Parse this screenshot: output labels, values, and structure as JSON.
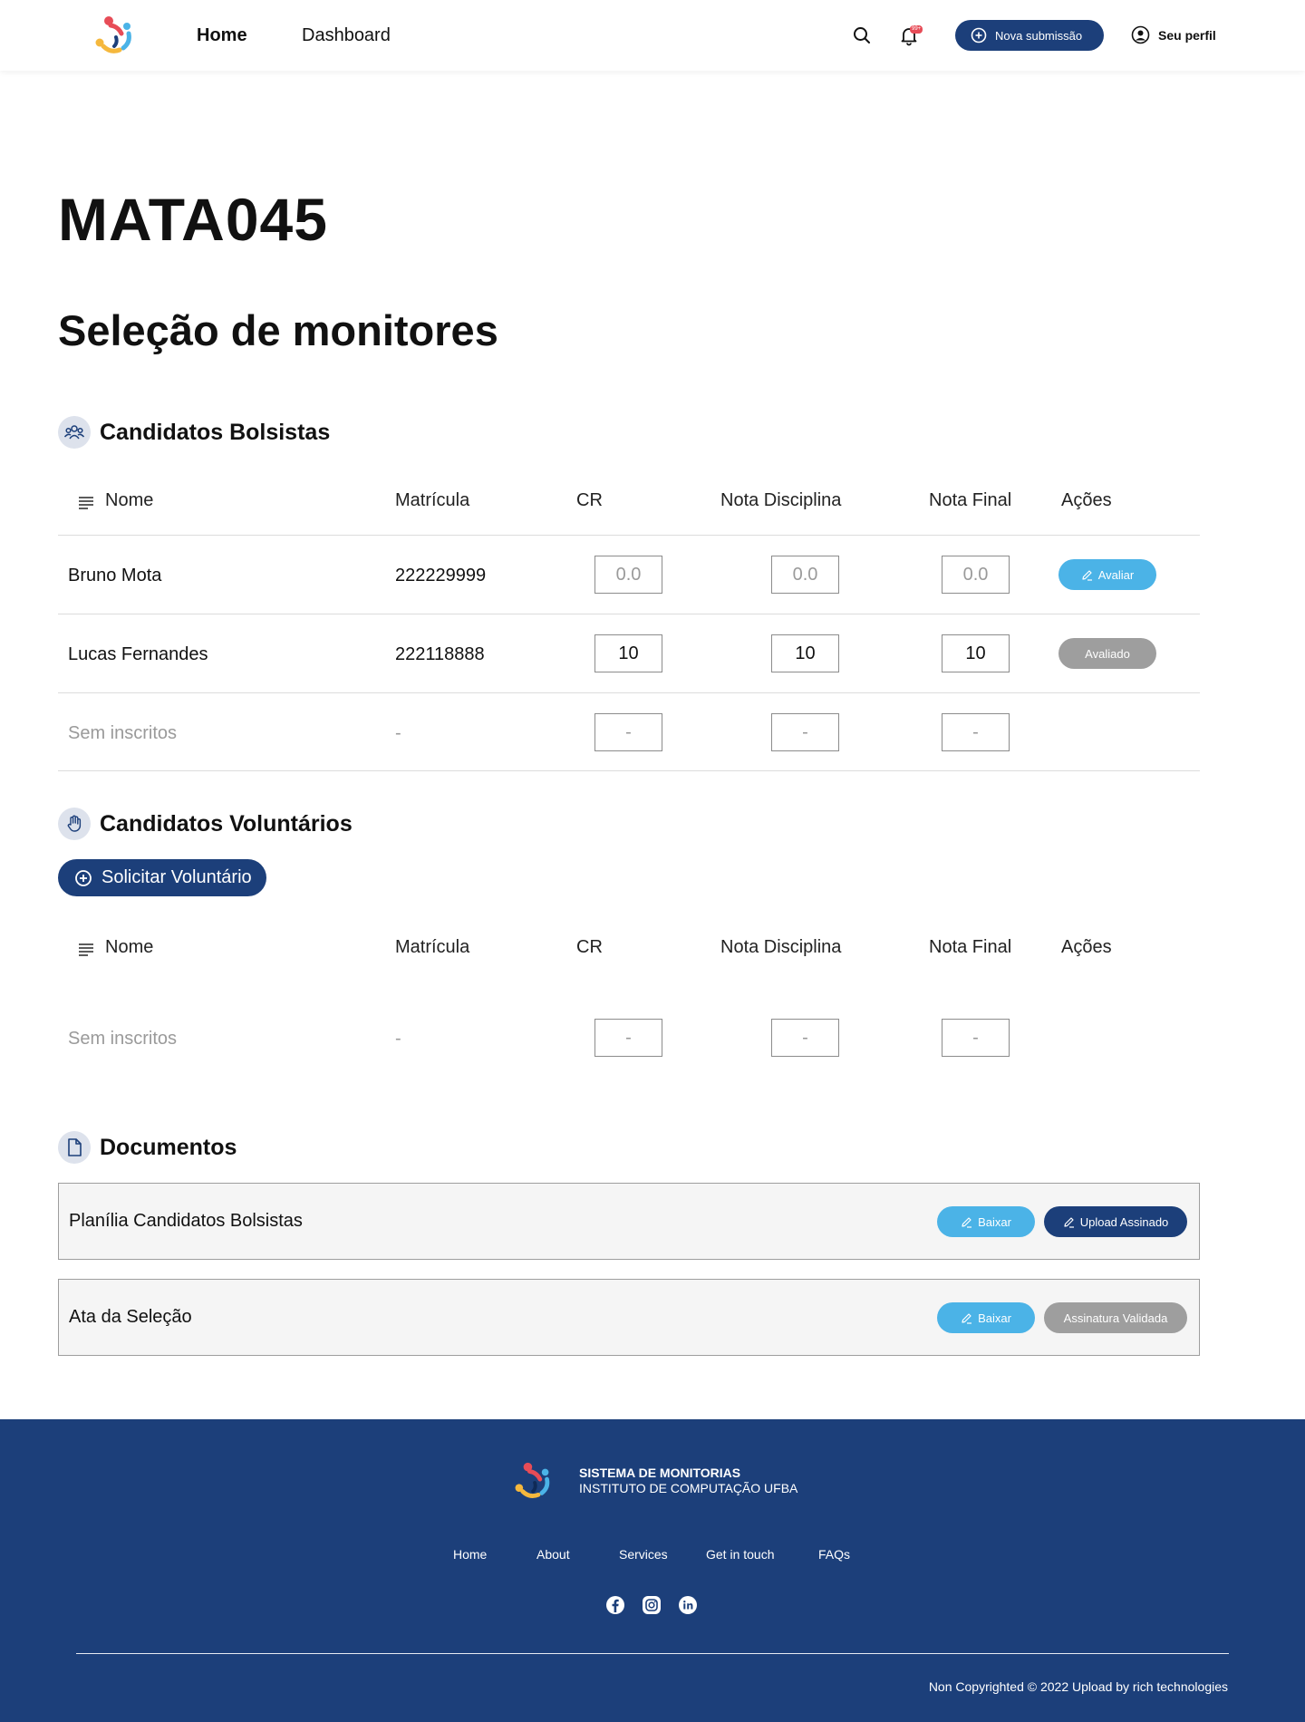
{
  "nav": {
    "home": "Home",
    "dashboard": "Dashboard",
    "notification_badge": "99+",
    "submit_button": "Nova submissão",
    "profile": "Seu perfil"
  },
  "page": {
    "course_code": "MATA045",
    "title": "Seleção de monitores"
  },
  "scholarship": {
    "heading": "Candidatos Bolsistas",
    "columns": [
      "Nome",
      "Matrícula",
      "CR",
      "Nota Disciplina",
      "Nota Final",
      "Ações"
    ],
    "rows": [
      {
        "name": "Bruno Mota",
        "id": "222229999",
        "cr": "0.0",
        "nota_disciplina": "0.0",
        "nota_final": "0.0",
        "action": "Avaliar"
      },
      {
        "name": "Lucas Fernandes",
        "id": "222118888",
        "cr": "10",
        "nota_disciplina": "10",
        "nota_final": "10",
        "action": "Avaliado"
      },
      {
        "name": "Sem inscritos",
        "id": "-",
        "cr": "-",
        "nota_disciplina": "-",
        "nota_final": "-"
      }
    ]
  },
  "volunteer": {
    "heading": "Candidatos Voluntários",
    "request_button": "Solicitar Voluntário",
    "columns": [
      "Nome",
      "Matrícula",
      "CR",
      "Nota Disciplina",
      "Nota Final",
      "Ações"
    ],
    "rows": [
      {
        "name": "Sem inscritos",
        "id": "-",
        "cr": "-",
        "nota_disciplina": "-",
        "nota_final": "-"
      }
    ]
  },
  "documents": {
    "heading": "Documentos",
    "items": [
      {
        "name": "Planília Candidatos Bolsistas",
        "download": "Baixar",
        "status": "Upload Assinado"
      },
      {
        "name": "Ata da Seleção",
        "download": "Baixar",
        "status": "Assinatura Validada"
      }
    ]
  },
  "footer": {
    "title": "SISTEMA DE MONITORIAS",
    "subtitle": "INSTITUTO DE COMPUTAÇÃO UFBA",
    "links": [
      "Home",
      "About",
      "Services",
      "Get in touch",
      "FAQs"
    ],
    "copyright": "Non Copyrighted © 2022 Upload by rich technologies"
  },
  "colors": {
    "navy": "#1c3f7a",
    "light_blue": "#4bb3e7",
    "gray_pill": "#9e9e9e",
    "badge_red": "#e74c57"
  },
  "icons": [
    "app-logo-icon",
    "search-icon",
    "bell-icon",
    "plus-circle-icon",
    "user-circle-icon",
    "group-icon",
    "hand-icon",
    "document-icon",
    "sort-lines-icon",
    "pencil-icon",
    "facebook-icon",
    "instagram-icon",
    "linkedin-icon"
  ]
}
